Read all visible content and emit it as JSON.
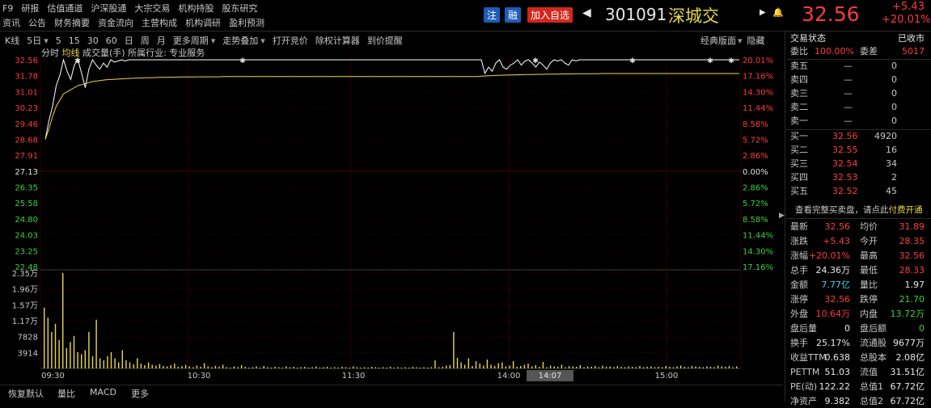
{
  "nav": {
    "row1": [
      "F9",
      "研报",
      "估值通道",
      "沪深股通",
      "大宗交易",
      "机构持股",
      "股东研究"
    ],
    "row2": [
      "资讯",
      "公告",
      "财务摘要",
      "资金流向",
      "主营构成",
      "机构调研",
      "盈利预测"
    ]
  },
  "header": {
    "zhu": "注",
    "rong": "融",
    "add_watch": "加入自选",
    "code": "301091",
    "name": "深城交",
    "price": "32.56",
    "change": "+5.43",
    "change_pct": "+20.01%"
  },
  "toolbar": {
    "items": [
      "K线",
      "5日",
      "5",
      "15",
      "30",
      "60",
      "日",
      "周",
      "月",
      "更多周期",
      "走势叠加",
      "打开竞价",
      "除权计算器",
      "到价提醒"
    ],
    "right": [
      "经典版面",
      "隐藏"
    ],
    "sub": [
      "分时",
      "均线",
      "成交量(手)",
      "所属行业: 专业服务"
    ]
  },
  "chart_data": {
    "type": "line",
    "prev_close": 27.13,
    "price_axis": [
      "32.56",
      "31.78",
      "31.01",
      "30.23",
      "29.46",
      "28.68",
      "27.91",
      "27.13",
      "26.35",
      "25.58",
      "24.80",
      "24.03",
      "23.25",
      "22.48"
    ],
    "pct_axis": [
      "20.01%",
      "17.16%",
      "14.30%",
      "11.44%",
      "8.58%",
      "5.72%",
      "2.86%",
      "0.00%",
      "2.86%",
      "5.72%",
      "8.58%",
      "11.44%",
      "14.30%",
      "17.16%"
    ],
    "volume_axis": [
      "2.35万",
      "1.96万",
      "1.57万",
      "1.17万",
      "7828",
      "3914"
    ],
    "time_axis": [
      "09:30",
      "10:30",
      "11:30",
      "14:00",
      "15:00"
    ],
    "cursor_time": "14:07",
    "ylim": [
      22.48,
      32.56
    ],
    "price": [
      28.68,
      29.6,
      30.3,
      31.3,
      31.8,
      32.56,
      32.0,
      31.6,
      32.3,
      32.56,
      31.9,
      31.2,
      32.1,
      32.56,
      32.3,
      32.1,
      32.4,
      32.2,
      32.56,
      32.45,
      32.5,
      32.56,
      32.5,
      32.56,
      32.56,
      32.56,
      32.56,
      32.56,
      32.56,
      32.56,
      32.56,
      32.56,
      32.56,
      32.56,
      32.56,
      32.56,
      32.56,
      32.56,
      32.56,
      32.56,
      32.56,
      32.56,
      32.56,
      32.56,
      32.56,
      32.56,
      32.56,
      32.56,
      32.56,
      32.56,
      32.56,
      32.56,
      32.56,
      32.56,
      32.56,
      32.56,
      32.56,
      32.56,
      32.56,
      32.56,
      32.56,
      32.56,
      32.56,
      32.56,
      32.56,
      32.56,
      32.56,
      32.56,
      32.56,
      32.56,
      32.56,
      32.56,
      32.56,
      32.56,
      32.56,
      32.56,
      32.56,
      32.56,
      32.56,
      32.56,
      32.56,
      32.56,
      32.56,
      32.56,
      32.56,
      32.56,
      32.56,
      32.56,
      32.56,
      32.56,
      32.56,
      32.56,
      32.56,
      32.56,
      32.56,
      32.56,
      32.56,
      32.56,
      32.56,
      32.56,
      32.56,
      32.56,
      32.56,
      32.56,
      32.56,
      32.56,
      32.56,
      32.56,
      32.56,
      32.56,
      32.56,
      32.56,
      32.56,
      32.56,
      32.56,
      32.56,
      32.56,
      32.56,
      32.56,
      32.56,
      32.56,
      31.9,
      32.2,
      32.0,
      32.4,
      32.56,
      32.2,
      32.1,
      32.3,
      32.4,
      32.56,
      32.3,
      32.5,
      32.56,
      32.4,
      32.2,
      32.45,
      32.3,
      32.1,
      32.4,
      32.56,
      32.5,
      32.56,
      32.4,
      32.3,
      32.56,
      32.5,
      32.56,
      32.56,
      32.56,
      32.56,
      32.56,
      32.56,
      32.56,
      32.56,
      32.56,
      32.56,
      32.56,
      32.56,
      32.56,
      32.56,
      32.56,
      32.56,
      32.56,
      32.56,
      32.56,
      32.56,
      32.56,
      32.56,
      32.56,
      32.56,
      32.56,
      32.56,
      32.56,
      32.56,
      32.56,
      32.56,
      32.56,
      32.56,
      32.56,
      32.56,
      32.56,
      32.56,
      32.56,
      32.56,
      32.56,
      32.56,
      32.56,
      32.56,
      32.56,
      32.56,
      32.56
    ],
    "avg": [
      28.68,
      29.2,
      29.8,
      30.3,
      30.6,
      30.9,
      31.0,
      31.1,
      31.2,
      31.3,
      31.35,
      31.4,
      31.45,
      31.5,
      31.52,
      31.55,
      31.57,
      31.59,
      31.6,
      31.61,
      31.62,
      31.63,
      31.64,
      31.65,
      31.66,
      31.67,
      31.67,
      31.68,
      31.68,
      31.69,
      31.69,
      31.7,
      31.7,
      31.7,
      31.71,
      31.71,
      31.71,
      31.72,
      31.72,
      31.72,
      31.72,
      31.72,
      31.73,
      31.73,
      31.73,
      31.73,
      31.73,
      31.73,
      31.73,
      31.74,
      31.74,
      31.74,
      31.74,
      31.74,
      31.74,
      31.74,
      31.74,
      31.74,
      31.74,
      31.74,
      31.74,
      31.74,
      31.74,
      31.74,
      31.74,
      31.74,
      31.74,
      31.74,
      31.74,
      31.74,
      31.74,
      31.74,
      31.74,
      31.74,
      31.74,
      31.74,
      31.74,
      31.74,
      31.74,
      31.74,
      31.74,
      31.74,
      31.74,
      31.74,
      31.74,
      31.74,
      31.74,
      31.74,
      31.74,
      31.74,
      31.74,
      31.74,
      31.74,
      31.74,
      31.74,
      31.74,
      31.74,
      31.74,
      31.74,
      31.74,
      31.74,
      31.74,
      31.74,
      31.74,
      31.74,
      31.74,
      31.74,
      31.74,
      31.74,
      31.74,
      31.74,
      31.74,
      31.74,
      31.74,
      31.74,
      31.74,
      31.74,
      31.74,
      31.74,
      31.74,
      31.76,
      31.77,
      31.78,
      31.79,
      31.8,
      31.8,
      31.81,
      31.81,
      31.82,
      31.82,
      31.83,
      31.83,
      31.84,
      31.84,
      31.84,
      31.85,
      31.85,
      31.85,
      31.86,
      31.86,
      31.86,
      31.86,
      31.87,
      31.87,
      31.87,
      31.87,
      31.88,
      31.88,
      31.88,
      31.88,
      31.88,
      31.88,
      31.88,
      31.89,
      31.89,
      31.89,
      31.89,
      31.89,
      31.89,
      31.89,
      31.89,
      31.89,
      31.89,
      31.89,
      31.89,
      31.89,
      31.89,
      31.89,
      31.89,
      31.89,
      31.89,
      31.89,
      31.89,
      31.89,
      31.89,
      31.89,
      31.89,
      31.89,
      31.89,
      31.89,
      31.89,
      31.89,
      31.89,
      31.89,
      31.89,
      31.89,
      31.89,
      31.89,
      31.89,
      31.89,
      31.89,
      31.89
    ],
    "volume": [
      15000,
      12500,
      9000,
      11000,
      7000,
      23500,
      5000,
      6500,
      8000,
      4000,
      3500,
      4500,
      9000,
      3000,
      12000,
      2500,
      2000,
      3000,
      4000,
      2500,
      1500,
      4500,
      2000,
      1500,
      1000,
      2500,
      1200,
      800,
      1500,
      900,
      700,
      1100,
      600,
      500,
      800,
      1200,
      400,
      600,
      900,
      500,
      300,
      700,
      400,
      1300,
      500,
      300,
      600,
      400,
      900,
      300,
      200,
      500,
      300,
      800,
      400,
      200,
      300,
      500,
      200,
      600,
      300,
      200,
      400,
      300,
      200,
      500,
      300,
      400,
      200,
      300,
      400,
      200,
      300,
      500,
      200,
      300,
      400,
      200,
      300,
      200,
      400,
      300,
      200,
      500,
      300,
      200,
      300,
      200,
      400,
      300,
      200,
      300,
      200,
      400,
      200,
      300,
      200,
      300,
      200,
      400,
      300,
      200,
      300,
      200,
      300,
      2000,
      300,
      400,
      700,
      800,
      9000,
      2600,
      1500,
      900,
      2500,
      600,
      1800,
      1200,
      700,
      2200,
      900,
      600,
      1300,
      1500,
      500,
      700,
      1800,
      400,
      600,
      900,
      1200,
      500,
      800,
      400,
      1600,
      300,
      700,
      500,
      400,
      900,
      300,
      600,
      500,
      400,
      800,
      300,
      500,
      400,
      600,
      300,
      700,
      400,
      500,
      300,
      600,
      400,
      300,
      500,
      400,
      300,
      600,
      300,
      400,
      500,
      300,
      400,
      300,
      600,
      400,
      300,
      500,
      700,
      400,
      300,
      600,
      500,
      400,
      300,
      500,
      400,
      300,
      700,
      500,
      400,
      600,
      300,
      500
    ]
  },
  "panel": {
    "title": "交易状态",
    "status": "已收市",
    "weibi_label": "委比",
    "weibi": "100.00%",
    "weicha_label": "委差",
    "weicha": "5017",
    "sell": [
      {
        "label": "卖五",
        "price": "—",
        "vol": "0"
      },
      {
        "label": "卖四",
        "price": "—",
        "vol": "0"
      },
      {
        "label": "卖三",
        "price": "—",
        "vol": "0"
      },
      {
        "label": "卖二",
        "price": "—",
        "vol": "0"
      },
      {
        "label": "卖一",
        "price": "—",
        "vol": "0"
      }
    ],
    "buy": [
      {
        "label": "买一",
        "price": "32.56",
        "vol": "4920"
      },
      {
        "label": "买二",
        "price": "32.55",
        "vol": "16"
      },
      {
        "label": "买三",
        "price": "32.54",
        "vol": "34"
      },
      {
        "label": "买四",
        "price": "32.53",
        "vol": "2"
      },
      {
        "label": "买五",
        "price": "32.52",
        "vol": "45"
      }
    ],
    "promo_text": "查看完整买卖盘，请点此",
    "promo_link": "付费开通",
    "stats": [
      {
        "l1": "最新",
        "v1": "32.56",
        "l2": "均价",
        "v2": "31.89"
      },
      {
        "l1": "涨跌",
        "v1": "+5.43",
        "l2": "今开",
        "v2": "28.35"
      },
      {
        "l1": "涨幅",
        "v1": "+20.01%",
        "l2": "最高",
        "v2": "32.56"
      },
      {
        "l1": "总手",
        "v1": "24.36万",
        "l2": "最低",
        "v2": "28.33"
      },
      {
        "l1": "金额",
        "v1": "7.77亿",
        "l2": "量比",
        "v2": "1.97"
      },
      {
        "l1": "涨停",
        "v1": "32.56",
        "l2": "跌停",
        "v2": "21.70"
      },
      {
        "l1": "外盘",
        "v1": "10.64万",
        "l2": "内盘",
        "v2": "13.72万"
      },
      {
        "l1": "盘后量",
        "v1": "0",
        "l2": "盘后额",
        "v2": "0"
      },
      {
        "l1": "换手",
        "v1": "25.17%",
        "l2": "流通股",
        "v2": "9677万"
      },
      {
        "l1": "收益TTM",
        "v1": "0.638",
        "l2": "总股本",
        "v2": "2.08亿"
      },
      {
        "l1": "PETTM",
        "v1": "51.03",
        "l2": "流值",
        "v2": "31.51亿"
      },
      {
        "l1": "PE(动)",
        "v1": "122.22",
        "l2": "总值1",
        "v2": "67.72亿"
      },
      {
        "l1": "净资产",
        "v1": "9.382",
        "l2": "总值2",
        "v2": "67.72亿"
      }
    ]
  },
  "bottom_tabs": [
    "恢复默认",
    "量比",
    "MACD",
    "更多"
  ],
  "colors": {
    "up": "#ff3b3b",
    "down": "#3bd13b",
    "price_line": "#ffffff",
    "avg_line": "#e8d84a",
    "vol_bar": "#e8d84a",
    "grid": "#3a0000"
  }
}
